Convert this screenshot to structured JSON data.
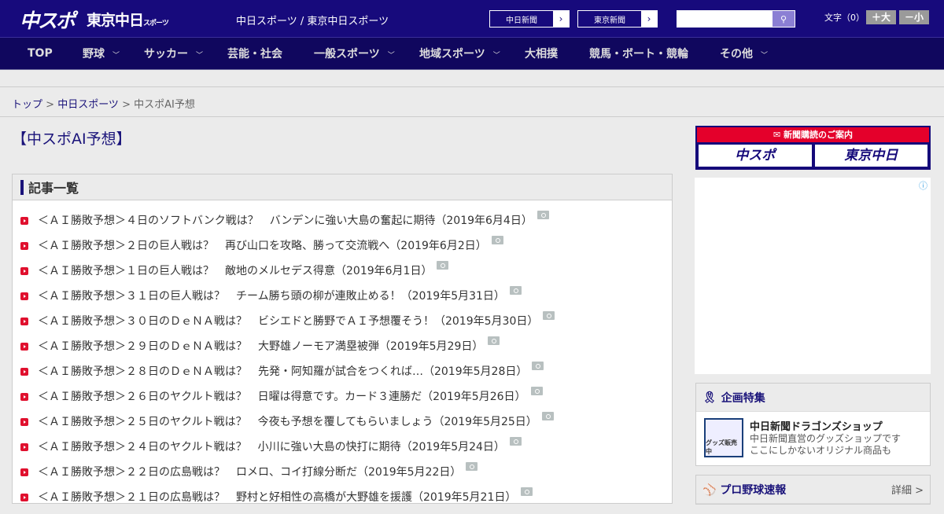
{
  "header": {
    "logo_chuspo": "中スポ",
    "logo_tokyo": "東京中日",
    "logo_tokyo_sub": "スポーツ",
    "tagline": "中日スポーツ / 東京中日スポーツ",
    "paper_links": [
      "中日新聞",
      "東京新聞"
    ],
    "search_placeholder": "",
    "font_label": "文字（0）",
    "font_larger": "＋大",
    "font_smaller": "－小"
  },
  "nav": [
    {
      "label": "TOP"
    },
    {
      "label": "野球"
    },
    {
      "label": "サッカー"
    },
    {
      "label": "芸能・社会"
    },
    {
      "label": "一般スポーツ"
    },
    {
      "label": "地域スポーツ"
    },
    {
      "label": "大相撲"
    },
    {
      "label": "競馬・ボート・競輪"
    },
    {
      "label": "その他"
    }
  ],
  "breadcrumb": {
    "top": "トップ",
    "sep": " > ",
    "section": "中日スポーツ",
    "current": "中スポAI予想"
  },
  "page_title": "【中スポAI予想】",
  "articles": {
    "heading": "記事一覧",
    "items": [
      "＜ＡＩ勝敗予想＞４日のソフトバンク戦は？　バンデンに強い大島の奮起に期待（2019年6月4日）",
      "＜ＡＩ勝敗予想＞２日の巨人戦は？　再び山口を攻略、勝って交流戦へ（2019年6月2日）",
      "＜ＡＩ勝敗予想＞１日の巨人戦は？　敵地のメルセデス得意（2019年6月1日）",
      "＜ＡＩ勝敗予想＞３１日の巨人戦は？　チーム勝ち頭の柳が連敗止める！（2019年5月31日）",
      "＜ＡＩ勝敗予想＞３０日のＤｅＮＡ戦は？　ビシエドと勝野でＡＩ予想覆そう！（2019年5月30日）",
      "＜ＡＩ勝敗予想＞２９日のＤｅＮＡ戦は？　大野雄ノーモア満塁被弾（2019年5月29日）",
      "＜ＡＩ勝敗予想＞２８日のＤｅＮＡ戦は？　先発・阿知羅が試合をつくれば…（2019年5月28日）",
      "＜ＡＩ勝敗予想＞２６日のヤクルト戦は？　日曜は得意です。カード３連勝だ（2019年5月26日）",
      "＜ＡＩ勝敗予想＞２５日のヤクルト戦は？　今夜も予想を覆してもらいましょう（2019年5月25日）",
      "＜ＡＩ勝敗予想＞２４日のヤクルト戦は？　小川に強い大島の快打に期待（2019年5月24日）",
      "＜ＡＩ勝敗予想＞２２日の広島戦は？　ロメロ、コイ打線分断だ（2019年5月22日）",
      "＜ＡＩ勝敗予想＞２１日の広島戦は？　野村と好相性の高橋が大野雄を援護（2019年5月21日）"
    ]
  },
  "sidebar": {
    "subscribe_title": "新聞購読のご案内",
    "subscribe_chuspo": "中スポ",
    "subscribe_tokyo": "東京中日",
    "ad_info": "ⓘ",
    "feature": {
      "heading": "企画特集",
      "thumb_text": "グッズ販売中",
      "title": "中日新聞ドラゴンズショップ",
      "desc1": "中日新聞直営のグッズショップです",
      "desc2": "ここにしかないオリジナル商品も"
    },
    "baseball": {
      "heading": "プロ野球速報",
      "detail": "詳細 >"
    }
  },
  "colors": {
    "header": "#170a7c",
    "nav": "#10075e",
    "accent": "#e4002b"
  }
}
